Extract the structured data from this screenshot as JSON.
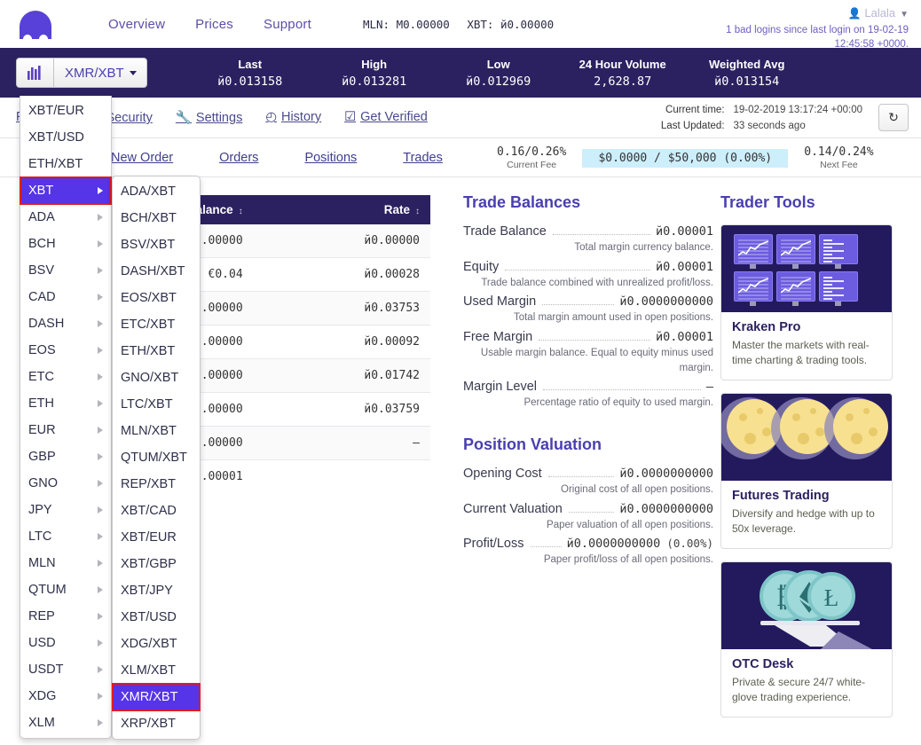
{
  "brand": {
    "logo": "kraken-logo"
  },
  "topnav": {
    "links": [
      "Overview",
      "Prices",
      "Support"
    ],
    "balances": [
      "MLN: M0.00000",
      "XBT: Ƀ.00000"
    ],
    "balance_mln": "MLN: M0.00000",
    "balance_xbt": "XBT: й0.00000",
    "username": "Lalala",
    "bad_logins": "1 bad logins since last login on 19-02-19 12:45:58 +0000."
  },
  "marketbar": {
    "pair": "XMR/XBT",
    "chart_icon": "bar-chart-icon",
    "stats": [
      {
        "label": "Last",
        "value": "й0.013158"
      },
      {
        "label": "High",
        "value": "й0.013281"
      },
      {
        "label": "Low",
        "value": "й0.012969"
      },
      {
        "label": "24 Hour Volume",
        "value": "2,628.87"
      },
      {
        "label": "Weighted Avg",
        "value": "й0.013154"
      }
    ]
  },
  "account_nav": {
    "links": [
      {
        "label": "Funding",
        "icon": ""
      },
      {
        "label": "Security",
        "icon": "🔒"
      },
      {
        "label": "Settings",
        "icon": "🔧"
      },
      {
        "label": "History",
        "icon": "◴"
      },
      {
        "label": "Get Verified",
        "icon": "☑"
      }
    ],
    "current_time_label": "Current time:",
    "current_time_value": "19-02-2019 13:17:24 +00:00",
    "last_updated_label": "Last Updated:",
    "last_updated_value": "33 seconds ago",
    "refresh_icon": "↻"
  },
  "tabs": [
    "New Order",
    "Orders",
    "Positions",
    "Trades"
  ],
  "fees": {
    "current_value": "0.16/0.26%",
    "current_caption": "Current Fee",
    "volume_bar": "$0.0000 / $50,000 (0.00%)",
    "next_value": "0.14/0.24%",
    "next_caption": "Next Fee"
  },
  "balances_table": {
    "columns": [
      "Balance",
      "Rate"
    ],
    "rows": [
      {
        "balance": "0.00000",
        "rate": "й0.00000"
      },
      {
        "balance": "€0.04",
        "rate": "й0.00028"
      },
      {
        "balance": "Ξ0.00000",
        "rate": "й0.03753"
      },
      {
        "balance": "ġ0.00000",
        "rate": "й0.00092"
      },
      {
        "balance": "ƿ0.00000",
        "rate": "й0.01742"
      },
      {
        "balance": "฿0.00000",
        "rate": "й0.03759"
      },
      {
        "balance": "й0.00000",
        "rate": "—"
      },
      {
        "balance": "й0.00001",
        "rate": ""
      }
    ]
  },
  "trade_balances": {
    "title": "Trade Balances",
    "items": [
      {
        "label": "Trade Balance",
        "value": "й0.00001",
        "desc": "Total margin currency balance."
      },
      {
        "label": "Equity",
        "value": "й0.00001",
        "desc": "Trade balance combined with unrealized profit/loss."
      },
      {
        "label": "Used Margin",
        "value": "й0.0000000000",
        "desc": "Total margin amount used in open positions."
      },
      {
        "label": "Free Margin",
        "value": "й0.00001",
        "desc": "Usable margin balance. Equal to equity minus used margin."
      },
      {
        "label": "Margin Level",
        "value": "—",
        "desc": "Percentage ratio of equity to used margin."
      }
    ]
  },
  "position_valuation": {
    "title": "Position Valuation",
    "items": [
      {
        "label": "Opening Cost",
        "value": "й0.0000000000",
        "pct": "",
        "desc": "Original cost of all open positions."
      },
      {
        "label": "Current Valuation",
        "value": "й0.0000000000",
        "pct": "",
        "desc": "Paper valuation of all open positions."
      },
      {
        "label": "Profit/Loss",
        "value": "й0.0000000000",
        "pct": "(0.00%)",
        "desc": "Paper profit/loss of all open positions."
      }
    ]
  },
  "trader_tools": {
    "title": "Trader Tools",
    "cards": [
      {
        "art": "monitors-art",
        "title": "Kraken Pro",
        "text": "Master the markets with real-time charting & trading tools."
      },
      {
        "art": "moons-art",
        "title": "Futures Trading",
        "text": "Diversify and hedge with up to 50x leverage."
      },
      {
        "art": "coins-tray-art",
        "title": "OTC Desk",
        "text": "Private & secure 24/7 white-glove trading experience."
      }
    ]
  },
  "pair_menu": {
    "level1": [
      {
        "label": "XBT/EUR",
        "submenu": false,
        "selected": false,
        "highlight": false
      },
      {
        "label": "XBT/USD",
        "submenu": false,
        "selected": false,
        "highlight": false
      },
      {
        "label": "ETH/XBT",
        "submenu": false,
        "selected": false,
        "highlight": false
      },
      {
        "label": "XBT",
        "submenu": true,
        "selected": true,
        "highlight": true
      },
      {
        "label": "ADA",
        "submenu": true,
        "selected": false,
        "highlight": false
      },
      {
        "label": "BCH",
        "submenu": true,
        "selected": false,
        "highlight": false
      },
      {
        "label": "BSV",
        "submenu": true,
        "selected": false,
        "highlight": false
      },
      {
        "label": "CAD",
        "submenu": true,
        "selected": false,
        "highlight": false
      },
      {
        "label": "DASH",
        "submenu": true,
        "selected": false,
        "highlight": false
      },
      {
        "label": "EOS",
        "submenu": true,
        "selected": false,
        "highlight": false
      },
      {
        "label": "ETC",
        "submenu": true,
        "selected": false,
        "highlight": false
      },
      {
        "label": "ETH",
        "submenu": true,
        "selected": false,
        "highlight": false
      },
      {
        "label": "EUR",
        "submenu": true,
        "selected": false,
        "highlight": false
      },
      {
        "label": "GBP",
        "submenu": true,
        "selected": false,
        "highlight": false
      },
      {
        "label": "GNO",
        "submenu": true,
        "selected": false,
        "highlight": false
      },
      {
        "label": "JPY",
        "submenu": true,
        "selected": false,
        "highlight": false
      },
      {
        "label": "LTC",
        "submenu": true,
        "selected": false,
        "highlight": false
      },
      {
        "label": "MLN",
        "submenu": true,
        "selected": false,
        "highlight": false
      },
      {
        "label": "QTUM",
        "submenu": true,
        "selected": false,
        "highlight": false
      },
      {
        "label": "REP",
        "submenu": true,
        "selected": false,
        "highlight": false
      },
      {
        "label": "USD",
        "submenu": true,
        "selected": false,
        "highlight": false
      },
      {
        "label": "USDT",
        "submenu": true,
        "selected": false,
        "highlight": false
      },
      {
        "label": "XDG",
        "submenu": true,
        "selected": false,
        "highlight": false
      },
      {
        "label": "XLM",
        "submenu": true,
        "selected": false,
        "highlight": false
      }
    ],
    "level2": [
      {
        "label": "ADA/XBT",
        "selected": false,
        "highlight": false
      },
      {
        "label": "BCH/XBT",
        "selected": false,
        "highlight": false
      },
      {
        "label": "BSV/XBT",
        "selected": false,
        "highlight": false
      },
      {
        "label": "DASH/XBT",
        "selected": false,
        "highlight": false
      },
      {
        "label": "EOS/XBT",
        "selected": false,
        "highlight": false
      },
      {
        "label": "ETC/XBT",
        "selected": false,
        "highlight": false
      },
      {
        "label": "ETH/XBT",
        "selected": false,
        "highlight": false
      },
      {
        "label": "GNO/XBT",
        "selected": false,
        "highlight": false
      },
      {
        "label": "LTC/XBT",
        "selected": false,
        "highlight": false
      },
      {
        "label": "MLN/XBT",
        "selected": false,
        "highlight": false
      },
      {
        "label": "QTUM/XBT",
        "selected": false,
        "highlight": false
      },
      {
        "label": "REP/XBT",
        "selected": false,
        "highlight": false
      },
      {
        "label": "XBT/CAD",
        "selected": false,
        "highlight": false
      },
      {
        "label": "XBT/EUR",
        "selected": false,
        "highlight": false
      },
      {
        "label": "XBT/GBP",
        "selected": false,
        "highlight": false
      },
      {
        "label": "XBT/JPY",
        "selected": false,
        "highlight": false
      },
      {
        "label": "XBT/USD",
        "selected": false,
        "highlight": false
      },
      {
        "label": "XDG/XBT",
        "selected": false,
        "highlight": false
      },
      {
        "label": "XLM/XBT",
        "selected": false,
        "highlight": false
      },
      {
        "label": "XMR/XBT",
        "selected": true,
        "highlight": true
      },
      {
        "label": "XRP/XBT",
        "selected": false,
        "highlight": false
      }
    ]
  },
  "colors": {
    "brand_purple": "#5741d9",
    "dark_navy": "#2b2160",
    "menu_selected": "#5634e8",
    "highlight_ring": "#e01b1b",
    "fee_bar": "#cdeefb",
    "link": "#4a4a8e"
  }
}
